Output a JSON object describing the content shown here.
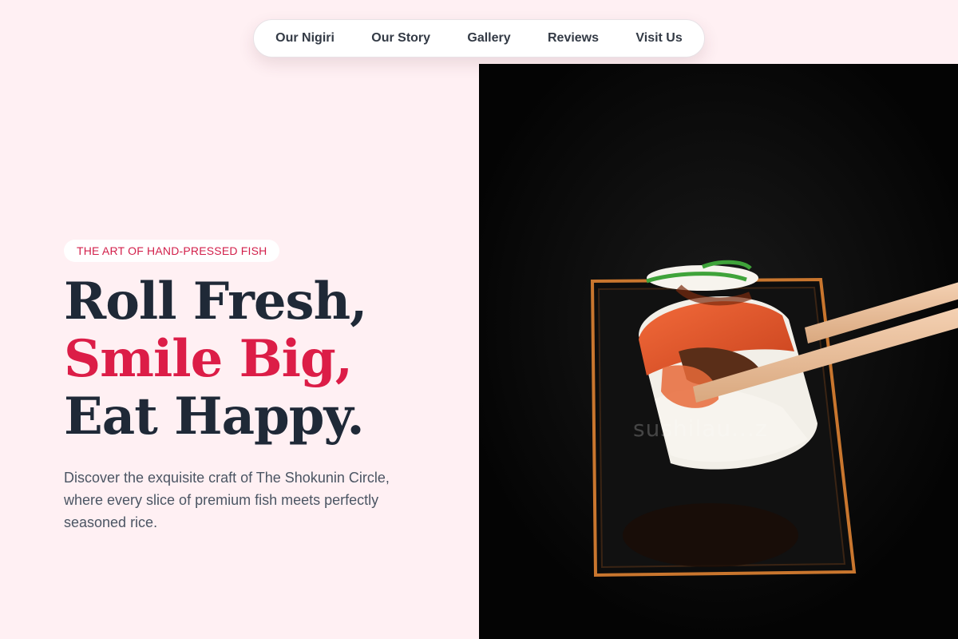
{
  "nav": {
    "items": [
      {
        "label": "Our Nigiri"
      },
      {
        "label": "Our Story"
      },
      {
        "label": "Gallery"
      },
      {
        "label": "Reviews"
      },
      {
        "label": "Visit Us"
      }
    ]
  },
  "hero": {
    "badge": "THE ART OF HAND-PRESSED FISH",
    "headline": {
      "line1": "Roll Fresh,",
      "line2": "Smile Big,",
      "line3": "Eat Happy."
    },
    "description": "Discover the exquisite craft of The Shokunin Circle, where every slice of premium fish meets perfectly seasoned rice.",
    "image": {
      "watermark": "sushilau...z"
    }
  },
  "colors": {
    "page_background": "#fff0f3",
    "accent": "#dc1d47",
    "heading": "#1f2937",
    "body_text": "#4b5563",
    "photo_background": "#060606"
  },
  "icons": []
}
